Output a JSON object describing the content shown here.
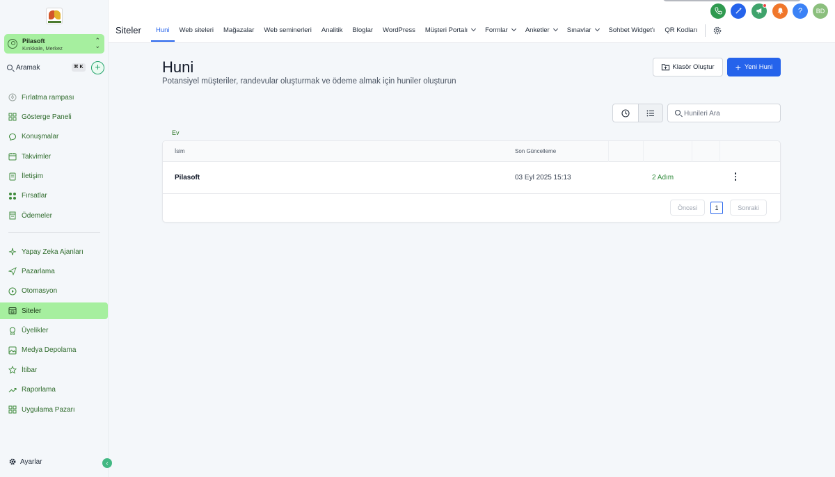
{
  "sidebar": {
    "account": {
      "name": "Pilasoft",
      "location": "Kırıkkale, Merkez"
    },
    "search": {
      "label": "Aramak",
      "shortcut": "⌘ K",
      "add": "+"
    },
    "nav_primary": [
      {
        "label": "Fırlatma rampası",
        "icon": "rocket-icon"
      },
      {
        "label": "Gösterge Paneli",
        "icon": "dashboard-icon"
      },
      {
        "label": "Konuşmalar",
        "icon": "chat-icon"
      },
      {
        "label": "Takvimler",
        "icon": "calendar-icon"
      },
      {
        "label": "İletişim",
        "icon": "contacts-icon"
      },
      {
        "label": "Fırsatlar",
        "icon": "opportunities-icon"
      },
      {
        "label": "Ödemeler",
        "icon": "payments-icon"
      }
    ],
    "nav_secondary": [
      {
        "label": "Yapay Zeka Ajanları",
        "icon": "sparkles-icon"
      },
      {
        "label": "Pazarlama",
        "icon": "send-icon"
      },
      {
        "label": "Otomasyon",
        "icon": "automation-icon"
      },
      {
        "label": "Siteler",
        "icon": "sites-icon",
        "active": true
      },
      {
        "label": "Üyelikler",
        "icon": "award-icon"
      },
      {
        "label": "Medya Depolama",
        "icon": "image-icon"
      },
      {
        "label": "İtibar",
        "icon": "star-icon"
      },
      {
        "label": "Raporlama",
        "icon": "chart-icon"
      },
      {
        "label": "Uygulama Pazarı",
        "icon": "apps-icon"
      }
    ],
    "settings": "Ayarlar",
    "collapse": "‹"
  },
  "header": {
    "title": "Siteler",
    "tabs": [
      {
        "label": "Huni",
        "active": true
      },
      {
        "label": "Web siteleri"
      },
      {
        "label": "Mağazalar"
      },
      {
        "label": "Web seminerleri"
      },
      {
        "label": "Analitik"
      },
      {
        "label": "Bloglar"
      },
      {
        "label": "WordPress"
      },
      {
        "label": "Müşteri Portalı",
        "dropdown": true
      },
      {
        "label": "Formlar",
        "dropdown": true
      },
      {
        "label": "Anketler",
        "dropdown": true
      },
      {
        "label": "Sınavlar",
        "dropdown": true
      },
      {
        "label": "Sohbet Widget'ı"
      },
      {
        "label": "QR Kodları"
      }
    ],
    "icons": [
      {
        "name": "phone-icon",
        "color": "#2f9a4f",
        "glyph": "✆"
      },
      {
        "name": "magic-icon",
        "color": "#2563eb",
        "glyph": "✦"
      },
      {
        "name": "megaphone-icon",
        "color": "#3fa36b",
        "glyph": "📢"
      },
      {
        "name": "bell-icon",
        "color": "#f0772b",
        "glyph": "🔔"
      },
      {
        "name": "help-icon",
        "color": "#3b82f6",
        "glyph": "?"
      },
      {
        "name": "avatar",
        "color": "#8bbf7d",
        "glyph": "BD"
      }
    ]
  },
  "main": {
    "title": "Huni",
    "subtitle": "Potansiyel müşteriler, randevular oluşturmak ve ödeme almak için huniler oluşturun",
    "create_folder": "Klasör Oluştur",
    "new_funnel": "Yeni Huni",
    "search_placeholder": "Hunileri Ara",
    "breadcrumb": "Ev",
    "table": {
      "columns": [
        "İsim",
        "Son Güncelleme"
      ],
      "rows": [
        {
          "name": "Pilasoft",
          "updated": "03 Eyl 2025 15:13",
          "steps": "2 Adım"
        }
      ]
    },
    "pagination": {
      "prev": "Öncesi",
      "page": "1",
      "next": "Sonraki"
    }
  },
  "colors": {
    "accent": "#2563eb",
    "sidebar_active": "#a6ef9f",
    "nav_text": "#2d6a2a"
  }
}
